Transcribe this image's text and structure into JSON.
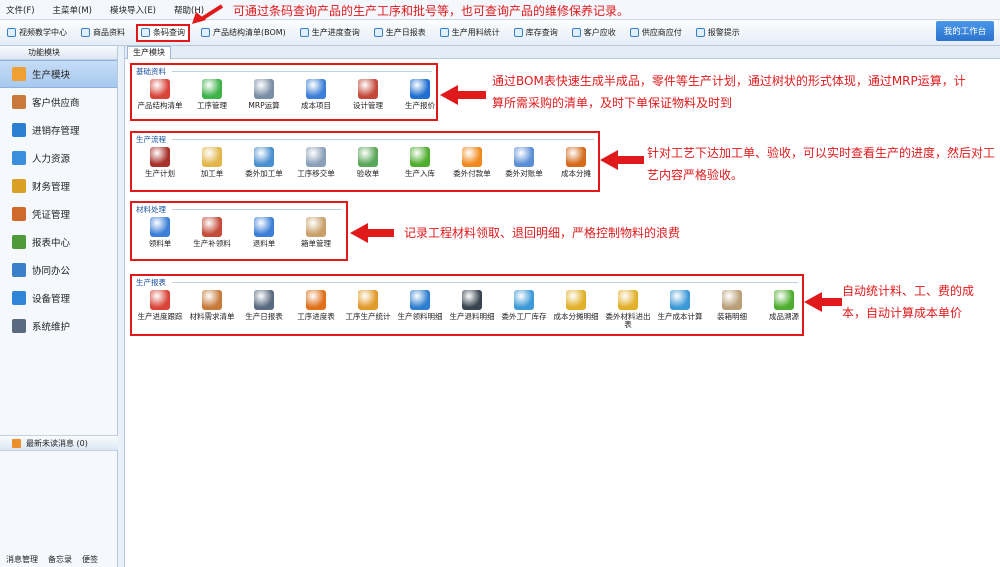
{
  "menu": [
    "文件(F)",
    "主菜单(M)",
    "模块导入(E)",
    "帮助(H)"
  ],
  "toolbar": {
    "items": [
      {
        "label": "视频教学中心"
      },
      {
        "label": "商品资料"
      },
      {
        "label": "条码查询"
      },
      {
        "label": "产品结构清单(BOM)"
      },
      {
        "label": "生产进度查询"
      },
      {
        "label": "生产日报表"
      },
      {
        "label": "生产用料统计"
      },
      {
        "label": "库存查询"
      },
      {
        "label": "客户应收"
      },
      {
        "label": "供应商应付"
      },
      {
        "label": "报警提示"
      }
    ],
    "workbench": "我的工作台"
  },
  "sidebar": {
    "header": "功能模块",
    "items": [
      {
        "label": "生产模块",
        "icon": "folder-icon",
        "color": "#f0a030"
      },
      {
        "label": "客户供应商",
        "icon": "people-icon",
        "color": "#c97a3a"
      },
      {
        "label": "进销存管理",
        "icon": "chart-icon",
        "color": "#2d7fd1"
      },
      {
        "label": "人力资源",
        "icon": "person-icon",
        "color": "#3a8edc"
      },
      {
        "label": "财务管理",
        "icon": "coins-icon",
        "color": "#d9a024"
      },
      {
        "label": "凭证管理",
        "icon": "voucher-icon",
        "color": "#d06a2a"
      },
      {
        "label": "报表中心",
        "icon": "report-icon",
        "color": "#4f9a3a"
      },
      {
        "label": "协同办公",
        "icon": "calendar-icon",
        "color": "#3a7fc8"
      },
      {
        "label": "设备管理",
        "icon": "device-icon",
        "color": "#2f86d8"
      },
      {
        "label": "系统维护",
        "icon": "lock-icon",
        "color": "#5a6a80"
      }
    ],
    "message": "最新未读消息 (0)",
    "bottom": [
      "消息管理",
      "备忘录",
      "便签"
    ]
  },
  "main": {
    "tab": "生产模块",
    "groups": [
      {
        "title": "基础资料",
        "items": [
          {
            "label": "产品结构清单",
            "color": "#d9453a"
          },
          {
            "label": "工序管理",
            "color": "#3fb24a"
          },
          {
            "label": "MRP运算",
            "color": "#7a8ea6"
          },
          {
            "label": "成本项目",
            "color": "#3d7fd8"
          },
          {
            "label": "设计管理",
            "color": "#c34a3a"
          },
          {
            "label": "生产报价",
            "color": "#1f6fd0"
          }
        ]
      },
      {
        "title": "生产流程",
        "items": [
          {
            "label": "生产计划",
            "color": "#a8302a"
          },
          {
            "label": "加工单",
            "color": "#e2b64a"
          },
          {
            "label": "委外加工单",
            "color": "#4a8fcf"
          },
          {
            "label": "工序移交单",
            "color": "#8aa0b8"
          },
          {
            "label": "验收单",
            "color": "#5aa65a"
          },
          {
            "label": "生产入库",
            "color": "#4fae2f"
          },
          {
            "label": "委外付款单",
            "color": "#f08a1e"
          },
          {
            "label": "委外对账单",
            "color": "#5a8fd6"
          },
          {
            "label": "成本分摊",
            "color": "#d46a1a"
          }
        ]
      },
      {
        "title": "材料处理",
        "items": [
          {
            "label": "领料单",
            "color": "#3d7fd8"
          },
          {
            "label": "生产补领料",
            "color": "#c44a3a"
          },
          {
            "label": "退料单",
            "color": "#3d7fd8"
          },
          {
            "label": "箱单管理",
            "color": "#c9a06a"
          }
        ]
      },
      {
        "title": "生产报表",
        "items": [
          {
            "label": "生产进度跟踪",
            "color": "#d9453a"
          },
          {
            "label": "材料需求清单",
            "color": "#c77a3a"
          },
          {
            "label": "生产日报表",
            "color": "#5a6a80"
          },
          {
            "label": "工序进度表",
            "color": "#e0701a"
          },
          {
            "label": "工序生产统计",
            "color": "#e29a2a"
          },
          {
            "label": "生产领料明细",
            "color": "#2f7fd0"
          },
          {
            "label": "生产退料明细",
            "color": "#3a4450"
          },
          {
            "label": "委外工厂库存",
            "color": "#3d9ad8"
          },
          {
            "label": "成本分摊明细",
            "color": "#e2b02a"
          },
          {
            "label": "委外材料进出表",
            "color": "#e2b02a"
          },
          {
            "label": "生产成本计算",
            "color": "#3d9ad8"
          },
          {
            "label": "装箱明细",
            "color": "#b9a07a"
          },
          {
            "label": "成品溯源",
            "color": "#4fae2f"
          }
        ]
      }
    ]
  },
  "annotations": {
    "top": "可通过条码查询产品的生产工序和批号等，也可查询产品的维修保养记录。",
    "basic": "通过BOM表快速生成半成品，零件等生产计划，通过树状的形式体现，通过MRP运算，计算所需采购的清单，及时下单保证物料及时到",
    "flow": "针对工艺下达加工单、验收，可以实时查看生产的进度，然后对工艺内容严格验收。",
    "material": "记录工程材料领取、退回明细，严格控制物料的浪费",
    "report": "自动统计料、工、费的成本，自动计算成本单价"
  },
  "colors": {
    "accent": "#e0191b",
    "brand": "#2a72cf"
  }
}
